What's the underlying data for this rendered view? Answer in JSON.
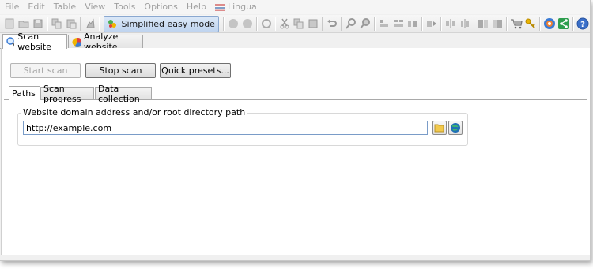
{
  "menu": {
    "items": [
      "File",
      "Edit",
      "Table",
      "View",
      "Tools",
      "Options",
      "Help",
      "Lingua"
    ]
  },
  "toolbar": {
    "mode_label": "Simplified easy mode",
    "icons": [
      "new-icon",
      "open-icon",
      "save-icon",
      "copy-icon",
      "paste-icon",
      "settings-icon",
      "mode-icon",
      "circle-icon",
      "circle-icon",
      "refresh-icon",
      "cut-icon",
      "copy-icon",
      "paste-icon",
      "undo-icon",
      "search-icon",
      "search-icon",
      "align-icon",
      "align-icon",
      "align-icon",
      "arrow-icon",
      "columns-icon",
      "columns-icon",
      "columns-icon",
      "columns-icon",
      "cart-icon",
      "key-icon",
      "home-icon",
      "share-icon",
      "help-icon"
    ]
  },
  "tabs": {
    "scan": "Scan website",
    "analyze": "Analyze website"
  },
  "buttons": {
    "start": "Start scan",
    "stop": "Stop scan",
    "presets": "Quick presets..."
  },
  "subtabs": {
    "paths": "Paths",
    "progress": "Scan progress",
    "collection": "Data collection"
  },
  "paths": {
    "legend": "Website domain address and/or root directory path",
    "url": "http://example.com"
  },
  "colors": {
    "accent": "#8aa8d0",
    "input_border": "#7a9cc8"
  }
}
